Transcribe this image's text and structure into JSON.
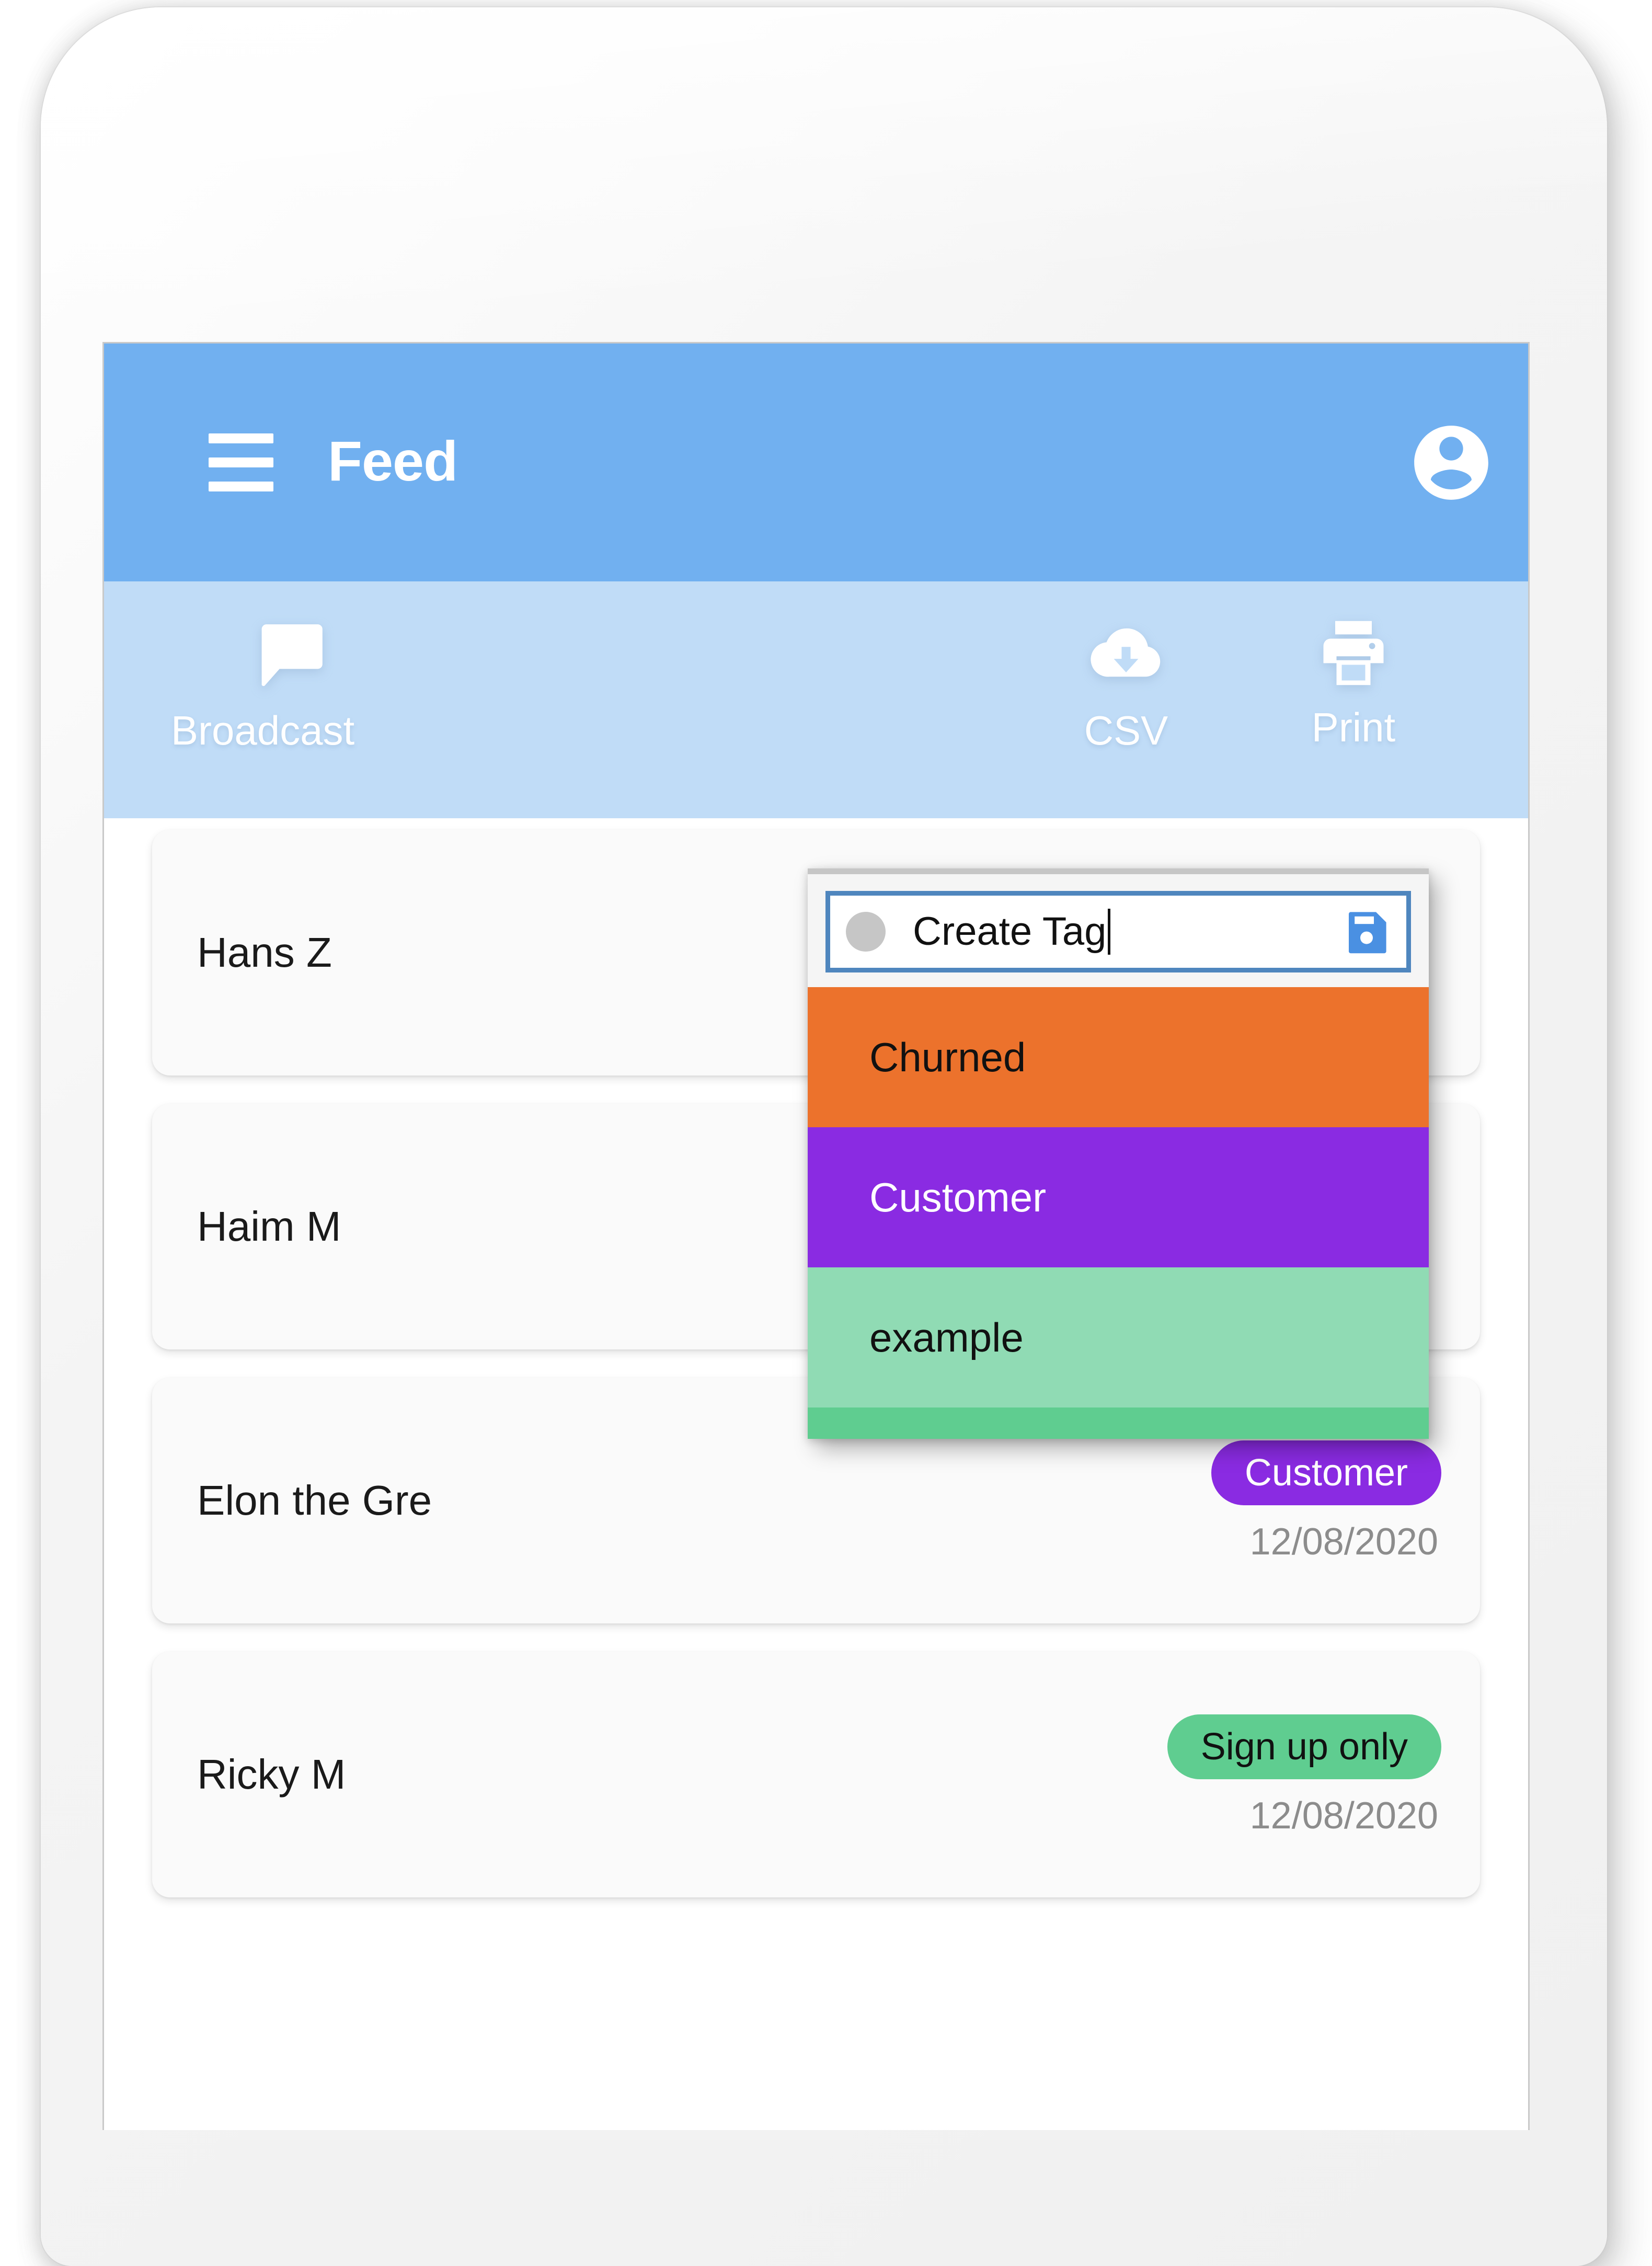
{
  "app": {
    "title": "Feed",
    "menu_icon": "hamburger-menu-icon",
    "account_icon": "account-circle-icon"
  },
  "toolbar": {
    "actions": [
      {
        "label": "Broadcast",
        "icon": "chat-bubble-icon"
      },
      {
        "label": "CSV",
        "icon": "cloud-download-icon"
      },
      {
        "label": "Print",
        "icon": "printer-icon"
      }
    ]
  },
  "feed": {
    "items": [
      {
        "name": "Hans Z",
        "badge": null,
        "date": null
      },
      {
        "name": "Haim M",
        "badge": null,
        "date": null
      },
      {
        "name": "Elon the Gre",
        "badge": "Customer",
        "badge_style": "customer",
        "date": "12/08/2020"
      },
      {
        "name": "Ricky M",
        "badge": "Sign up only",
        "badge_style": "signup",
        "date": "12/08/2020"
      }
    ]
  },
  "tag_popup": {
    "input_value": "Create Tag",
    "input_placeholder": "Create Tag",
    "color_dot": "#c6c6c6",
    "save_icon": "floppy-save-icon",
    "options": [
      {
        "label": "Churned",
        "bg": "#EC722C",
        "fg": "#111111"
      },
      {
        "label": "Customer",
        "bg": "#8A2BE2",
        "fg": "#ffffff"
      },
      {
        "label": "example",
        "bg": "#90DBB4",
        "fg": "#111111"
      },
      {
        "label": "",
        "bg": "#5FCD90",
        "fg": "#111111"
      }
    ]
  },
  "colors": {
    "appbar_blue": "#71B0F0",
    "toolbar_blue": "#C0DCF7",
    "badge_purple": "#8A2BE2",
    "badge_green": "#5FCD90",
    "input_border_blue": "#4F86BE",
    "save_icon_blue": "#4A90E2"
  }
}
